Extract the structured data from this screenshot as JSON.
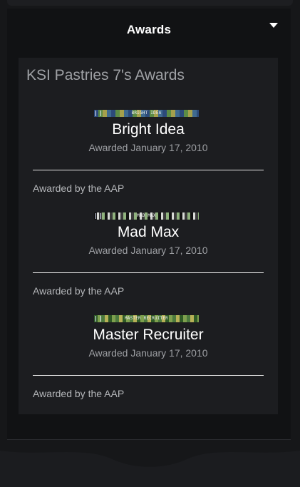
{
  "header": {
    "title": "Awards"
  },
  "card": {
    "title": "KSI Pastries 7's Awards"
  },
  "awards": [
    {
      "banner_text": "BRIGHT IDEA",
      "name": "Bright Idea",
      "date": "Awarded January 17, 2010",
      "awarded_by": "Awarded by the AAP"
    },
    {
      "banner_text": "MAD MAX",
      "name": "Mad Max",
      "date": "Awarded January 17, 2010",
      "awarded_by": "Awarded by the AAP"
    },
    {
      "banner_text": "MASTER RECRUITER",
      "name": "Master Recruiter",
      "date": "Awarded January 17, 2010",
      "awarded_by": "Awarded by the AAP"
    }
  ],
  "icons": {
    "toggle": "chevron-down-icon"
  },
  "colors": {
    "background": "#161719",
    "panel": "#111214",
    "card": "#1c1d20",
    "text_primary": "#ffffff",
    "text_secondary": "#9ea0a4"
  }
}
